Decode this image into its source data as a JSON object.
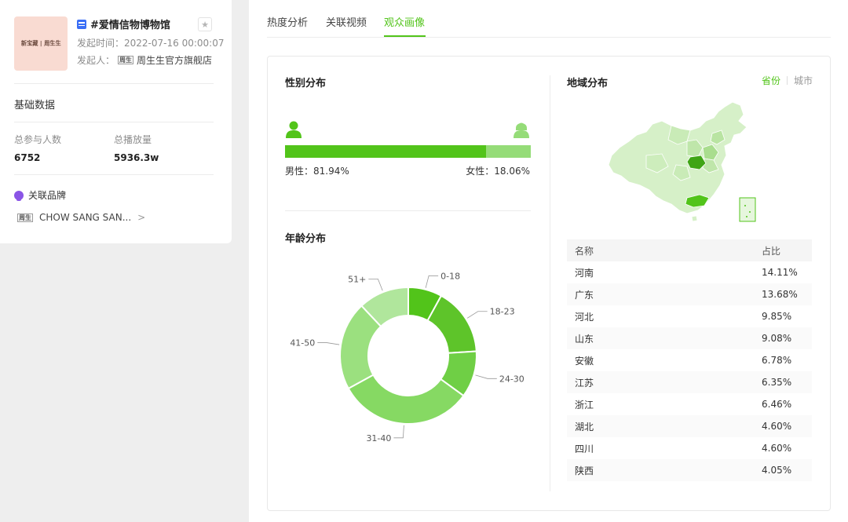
{
  "topic": {
    "thumb_text": "新宝藏 | 周生生",
    "title": "#爱情信物博物馆",
    "time_label": "发起时间：",
    "time_value": "2022-07-16 00:00:07",
    "owner_label": "发起人：",
    "owner_logo": "周生",
    "owner_name": "周生生官方旗舰店"
  },
  "basic": {
    "section_label": "基础数据",
    "participants_label": "总参与人数",
    "participants_value": "6752",
    "plays_label": "总播放量",
    "plays_value": "5936.3w"
  },
  "brand": {
    "section_label": "关联品牌",
    "logo": "周生",
    "name": "CHOW SANG SAN..."
  },
  "tabs": [
    {
      "label": "热度分析",
      "active": false
    },
    {
      "label": "关联视频",
      "active": false
    },
    {
      "label": "观众画像",
      "active": true
    }
  ],
  "gender": {
    "title": "性别分布",
    "male_label": "男性：81.94%",
    "female_label": "女性：18.06%",
    "male_share": 81.94,
    "female_share": 18.06,
    "male_color": "#52c41a",
    "female_color": "#95dc78"
  },
  "age": {
    "title": "年龄分布"
  },
  "chart_data": {
    "type": "pie",
    "labels": [
      "0-18",
      "18-23",
      "24-30",
      "31-40",
      "41-50",
      "51+"
    ],
    "values": [
      8,
      16,
      11,
      32,
      21,
      12
    ],
    "colors": [
      "#52c41a",
      "#5ec42a",
      "#6fcf45",
      "#86d963",
      "#9be07f",
      "#b0e69c"
    ],
    "donut": true
  },
  "region": {
    "title": "地域分布",
    "switch_province": "省份",
    "switch_city": "城市",
    "col_name": "名称",
    "col_pct": "占比",
    "rows": [
      {
        "name": "河南",
        "pct": "14.11%"
      },
      {
        "name": "广东",
        "pct": "13.68%"
      },
      {
        "name": "河北",
        "pct": "9.85%"
      },
      {
        "name": "山东",
        "pct": "9.08%"
      },
      {
        "name": "安徽",
        "pct": "6.78%"
      },
      {
        "name": "江苏",
        "pct": "6.35%"
      },
      {
        "name": "浙江",
        "pct": "6.46%"
      },
      {
        "name": "湖北",
        "pct": "4.60%"
      },
      {
        "name": "四川",
        "pct": "4.60%"
      },
      {
        "name": "陕西",
        "pct": "4.05%"
      }
    ]
  },
  "colors": {
    "accent": "#52c41a"
  }
}
